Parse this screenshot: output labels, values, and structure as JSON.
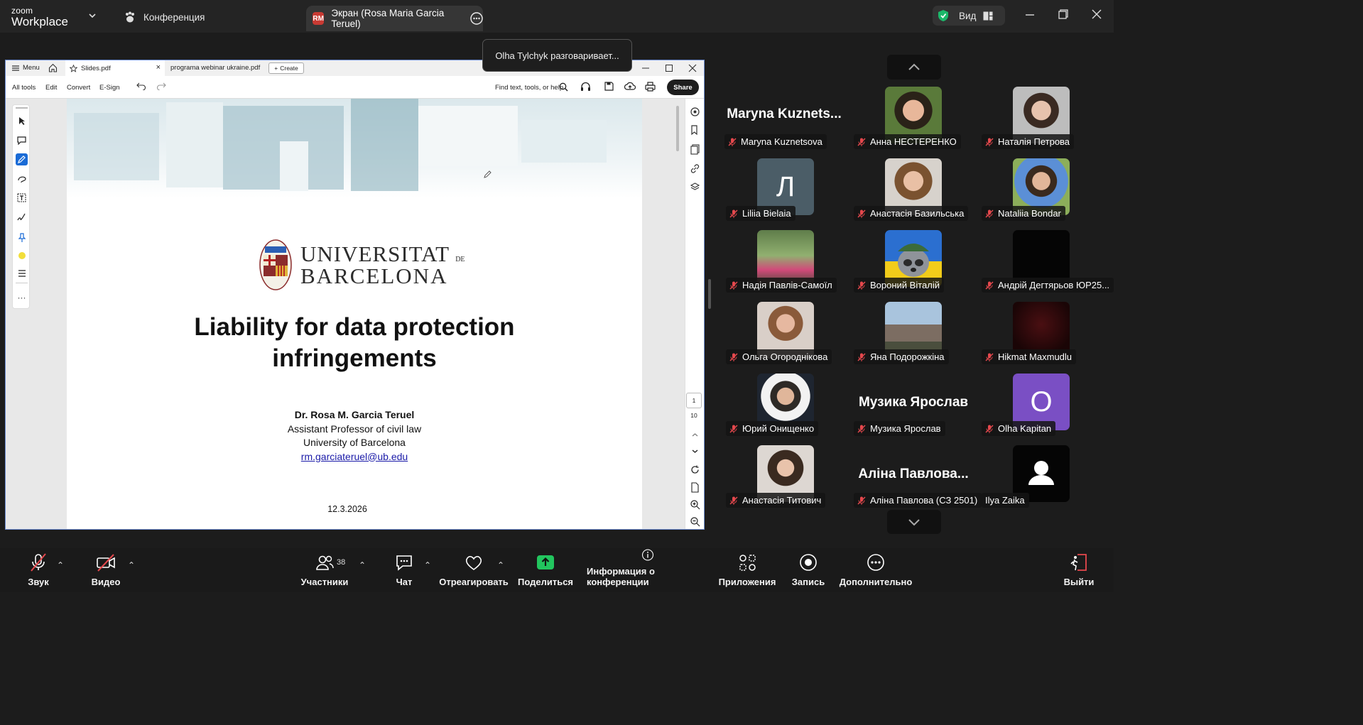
{
  "app": {
    "brand_line1": "zoom",
    "brand_line2": "Workplace"
  },
  "topbar": {
    "conference_tab": "Конференция",
    "screen_tab_initials": "RM",
    "screen_tab": "Экран (Rosa Maria Garcia Teruel)",
    "view_button": "Вид"
  },
  "notification": "Olha Tylchyk разговаривает...",
  "acrobat": {
    "menu": "Menu",
    "tab_active": "Slides.pdf",
    "tab_other": "programa webinar ukraine.pdf",
    "create": "Create",
    "toolbar": {
      "all_tools": "All tools",
      "edit": "Edit",
      "convert": "Convert",
      "esign": "E-Sign",
      "find": "Find text, tools, or help",
      "share": "Share"
    },
    "page_current": "1",
    "page_total": "10"
  },
  "slide": {
    "university_line1": "UNIVERSITAT",
    "university_de": "DE",
    "university_line2": "BARCELONA",
    "title_line1": "Liability for data protection",
    "title_line2": "infringements",
    "author_name": "Dr. Rosa M. Garcia Teruel",
    "author_position": "Assistant Professor of civil law",
    "author_affiliation": "University of Barcelona",
    "author_email": "rm.garciateruel@ub.edu",
    "date": "12.3.2026"
  },
  "participants": [
    {
      "name": "Maryna Kuznetsova",
      "big_name": "Maryna  Kuznets..."
    },
    {
      "name": "Анна НЕСТЕРЕНКО"
    },
    {
      "name": "Наталія Петрова"
    },
    {
      "name": "Liliia Bielaia",
      "initial": "Л"
    },
    {
      "name": "Анастасія Базильська"
    },
    {
      "name": "Nataliia Bondar"
    },
    {
      "name": "Надія Павлів-Самоїл"
    },
    {
      "name": "Вороний Віталій"
    },
    {
      "name": "Андрій Дегтярьов ЮР25..."
    },
    {
      "name": "Ольга Огороднікова"
    },
    {
      "name": "Яна Подорожкіна"
    },
    {
      "name": "Hikmat Maxmudlu"
    },
    {
      "name": "Юрий Онищенко"
    },
    {
      "name": "Музика Ярослав",
      "big_name": "Музика Ярослав"
    },
    {
      "name": "Olha Kapitan",
      "initial": "O"
    },
    {
      "name": "Анастасія Титович"
    },
    {
      "name": "Аліна Павлова (СЗ 2501)",
      "big_name": "Аліна  Павлова..."
    },
    {
      "name": "Ilya Zaika"
    }
  ],
  "bottombar": {
    "audio": "Звук",
    "video": "Видео",
    "participants": "Участники",
    "participants_count": "38",
    "chat": "Чат",
    "react": "Отреагировать",
    "share": "Поделиться",
    "info": "Информация о конференции",
    "apps": "Приложения",
    "record": "Запись",
    "more": "Дополнительно",
    "leave": "Выйти"
  },
  "colors": {
    "share_green": "#22c55e",
    "leave_red": "#e5484d",
    "muted_red": "#e5484d",
    "shield_green": "#1bb86a",
    "olha_purple": "#7a4fc4",
    "liliia_slate": "#4b5d67"
  }
}
